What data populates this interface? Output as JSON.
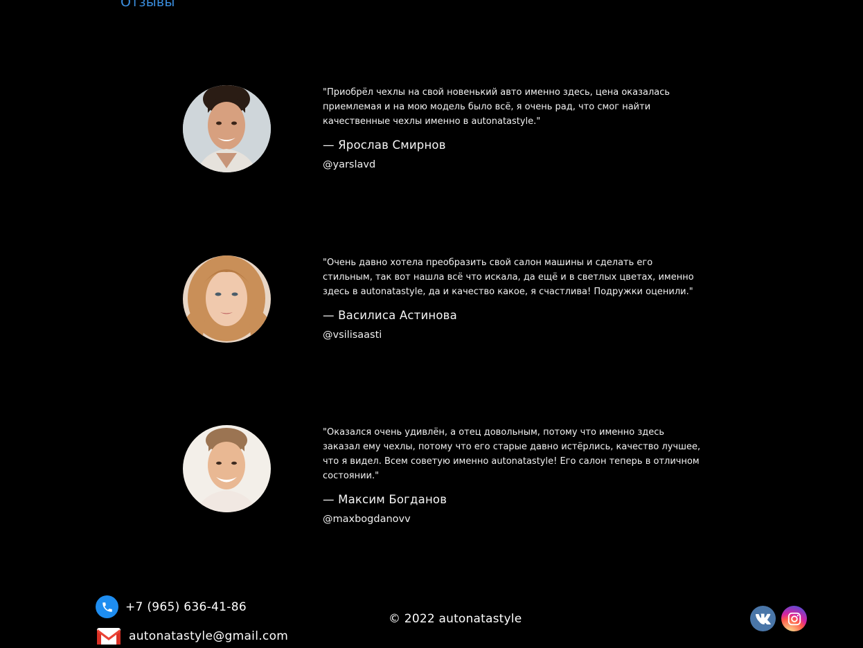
{
  "section": {
    "title": "Отзывы"
  },
  "reviews": [
    {
      "quote": "\"Приобрёл чехлы на свой новенький авто именно здесь, цена оказалась приемлемая и на мою модель было всё, я очень рад, что смог найти качественные чехлы именно в autonatastyle.\"",
      "author": "— Ярослав Смирнов",
      "handle": "@yarslavd"
    },
    {
      "quote": "\"Очень давно хотела преобразить свой салон машины и сделать его стильным, так вот нашла всё что искала, да ещё и в светлых цветах, именно здесь в autonatastyle, да и качество какое, я счастлива! Подружки оценили.\"",
      "author": "— Василиса Астинова",
      "handle": "@vsilisaasti"
    },
    {
      "quote": "\"Оказался очень удивлён, а отец довольным, потому что именно здесь заказал ему чехлы, потому что его старые давно истёрлись, качество лучшее, что я видел. Всем советую именно autonatastyle! Его салон теперь в отличном состоянии.\"",
      "author": "— Максим Богданов",
      "handle": "@maxbogdanovv"
    }
  ],
  "footer": {
    "phone": "+7 (965) 636-41-86",
    "email": "autonatastyle@gmail.com",
    "copyright": "© 2022 autonatastyle",
    "icons": [
      "phone-icon",
      "gmail-icon",
      "vk-icon",
      "instagram-icon"
    ]
  },
  "colors": {
    "background": "#000000",
    "title_blue": "#3b8fe0",
    "phone_blue": "#1e8df0",
    "vk_blue": "#4a76a8"
  }
}
